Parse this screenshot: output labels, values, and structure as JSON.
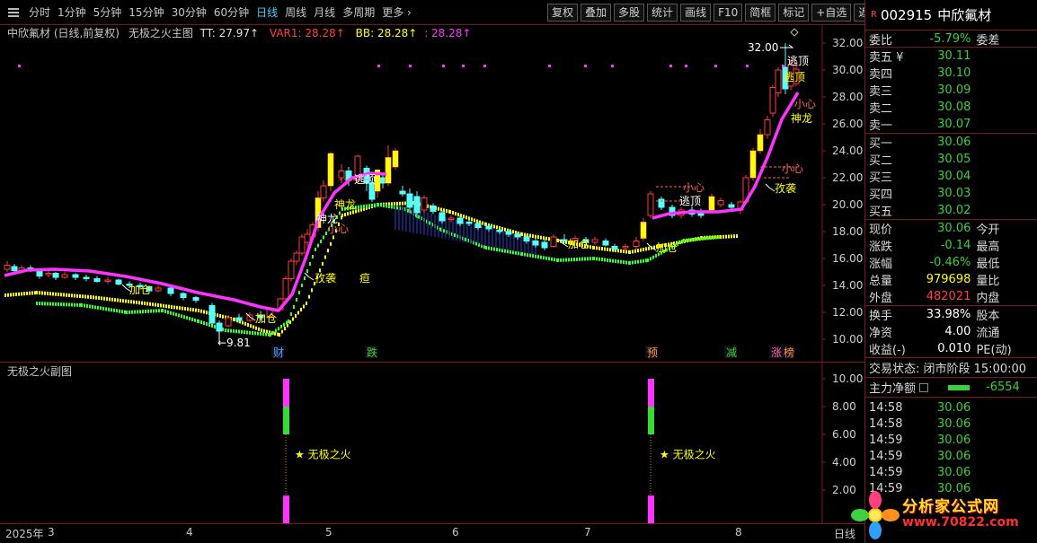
{
  "toolbar": {
    "periods": [
      "分时",
      "1分钟",
      "5分钟",
      "15分钟",
      "30分钟",
      "60分钟",
      "日线",
      "周线",
      "月线",
      "多周期",
      "更多 ›"
    ],
    "active_period": 6,
    "buttons": [
      "复权",
      "叠加",
      "多股",
      "统计",
      "画线",
      "F10",
      "简框",
      "标记",
      "+自选",
      "返回"
    ]
  },
  "main": {
    "title": "中欣氟材 (日线,前复权)",
    "indicator": "无极之火主图",
    "tt_label": "TT: 27.97↑",
    "var1_label": "VAR1: 28.28↑",
    "bb_label": "BB: 28.28↑",
    "last_label": ": 28.28↑",
    "y_ticks": [
      "32.00",
      "30.00",
      "28.00",
      "26.00",
      "24.00",
      "22.00",
      "20.00",
      "18.00",
      "16.00",
      "14.00",
      "12.00",
      "10.00"
    ],
    "high_mark": "32.00",
    "low_mark": "9.81",
    "signals": {
      "jiacang": "加仓",
      "taotding": "逃顶",
      "shenlong": "神龙",
      "xiaoxin": "小心",
      "zhuixi": "孜袭",
      "chuang": "疸"
    },
    "event_tags": [
      {
        "text": "财",
        "color": "#4fa0ff"
      },
      {
        "text": "跌",
        "color": "#3ad13a"
      },
      {
        "text": "预",
        "color": "#ff9040"
      },
      {
        "text": "减",
        "color": "#3ad13a"
      },
      {
        "text": "涨",
        "color": "#ff60a0"
      },
      {
        "text": "榜",
        "color": "#ff9040"
      }
    ],
    "colors": {
      "up": "#ff3b3b",
      "down": "#54ffff",
      "yellow": "#ffff00",
      "magenta": "#ff33ff",
      "green": "#33ff33"
    }
  },
  "sub": {
    "title": "无极之火副图",
    "y_ticks": [
      "10.00",
      "8.00",
      "6.00",
      "4.00",
      "2.00"
    ],
    "signal_text": "★ 无极之火"
  },
  "x_axis": {
    "labels": [
      "2025年",
      "3",
      "4",
      "5",
      "6",
      "7",
      "8"
    ],
    "right_label": "日线"
  },
  "quote": {
    "code": "002915",
    "name": "中欣氟材",
    "weibi_label": "委比",
    "weibi_value": "-5.79%",
    "weicha_label": "委差",
    "asks": [
      {
        "label": "卖五 ¥",
        "price": "30.11"
      },
      {
        "label": "卖四",
        "price": "30.10"
      },
      {
        "label": "卖三",
        "price": "30.09"
      },
      {
        "label": "卖二",
        "price": "30.08"
      },
      {
        "label": "卖一",
        "price": "30.07"
      }
    ],
    "bids": [
      {
        "label": "买一",
        "price": "30.06"
      },
      {
        "label": "买二",
        "price": "30.05"
      },
      {
        "label": "买三",
        "price": "30.04"
      },
      {
        "label": "买四",
        "price": "30.03"
      },
      {
        "label": "买五",
        "price": "30.02"
      }
    ],
    "stats": [
      {
        "l": "现价",
        "v": "30.06",
        "vc": "g",
        "r": "今开"
      },
      {
        "l": "涨跌",
        "v": "-0.14",
        "vc": "g",
        "r": "最高"
      },
      {
        "l": "涨幅",
        "v": "-0.46%",
        "vc": "g",
        "r": "最低"
      },
      {
        "l": "总量",
        "v": "979698",
        "vc": "y",
        "r": "量比"
      },
      {
        "l": "外盘",
        "v": "482021",
        "vc": "r",
        "r": "内盘"
      }
    ],
    "stats2": [
      {
        "l": "换手",
        "v": "33.98%",
        "r": "股本"
      },
      {
        "l": "净资",
        "v": "4.00",
        "r": "流通"
      },
      {
        "l": "收益(-)",
        "v": "0.010",
        "r": "PE(动)"
      }
    ],
    "trade_status": "交易状态: 闭市阶段 15:00:00",
    "main_flow_label": "主力净额",
    "main_flow_value": "-6554",
    "ticks": [
      {
        "t": "14:58",
        "p": "30.06"
      },
      {
        "t": "14:58",
        "p": "30.06"
      },
      {
        "t": "14:59",
        "p": "30.06"
      },
      {
        "t": "14:59",
        "p": "30.06"
      },
      {
        "t": "14:59",
        "p": "30.06"
      },
      {
        "t": "14:59",
        "p": "30.06"
      }
    ]
  },
  "watermark": {
    "title": "分析家公式网",
    "url": "www.70822.com"
  }
}
